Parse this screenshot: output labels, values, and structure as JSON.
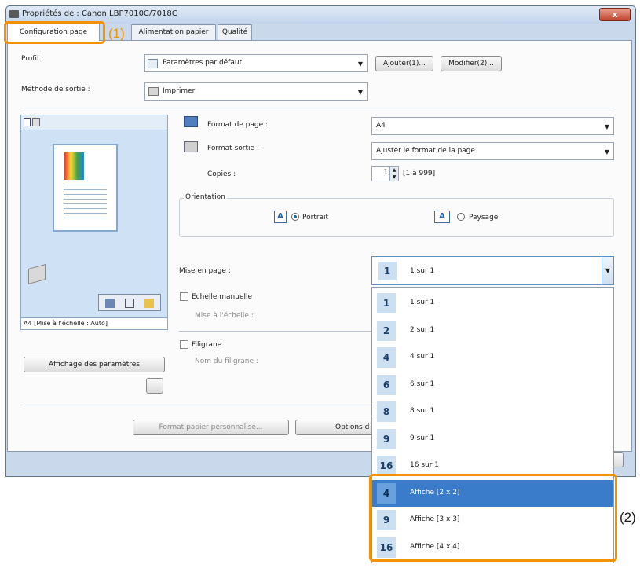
{
  "window": {
    "title": "Propriétés de : Canon LBP7010C/7018C",
    "close": "x"
  },
  "tabs": [
    {
      "label": "Configuration page"
    },
    {
      "label": "Alimentation papier"
    },
    {
      "label": "Qualité"
    }
  ],
  "markers": {
    "m1": "(1)",
    "m2": "(2)"
  },
  "profile": {
    "label": "Profil :",
    "value": "Paramètres par défaut",
    "add_button": "Ajouter(1)...",
    "edit_button": "Modifier(2)..."
  },
  "output_method": {
    "label": "Méthode de sortie :",
    "value": "Imprimer"
  },
  "page_size": {
    "label": "Format de page :",
    "value": "A4"
  },
  "output_size": {
    "label": "Format sortie :",
    "value": "Ajuster le format de la page"
  },
  "copies": {
    "label": "Copies :",
    "value": "1",
    "range": "[1 à 999]"
  },
  "orientation": {
    "title": "Orientation",
    "portrait": "Portrait",
    "landscape": "Paysage"
  },
  "layout": {
    "label": "Mise en page :",
    "value": "1 sur 1",
    "value_num": "1"
  },
  "manual_scale": {
    "label": "Echelle manuelle",
    "sub_label": "Mise à l'échelle :"
  },
  "watermark": {
    "label": "Filigrane",
    "sub_label": "Nom du filigrane :"
  },
  "preview": {
    "status": "A4 [Mise à l'échelle : Auto]"
  },
  "buttons": {
    "show_settings": "Affichage des paramètres",
    "custom_paper": "Format papier personnalisé...",
    "page_options": "Options d"
  },
  "dropdown": {
    "items": [
      {
        "num": "1",
        "label": "1 sur 1",
        "selected": false
      },
      {
        "num": "2",
        "label": "2 sur 1",
        "selected": false
      },
      {
        "num": "4",
        "label": "4 sur 1",
        "selected": false
      },
      {
        "num": "6",
        "label": "6 sur 1",
        "selected": false
      },
      {
        "num": "8",
        "label": "8 sur 1",
        "selected": false
      },
      {
        "num": "9",
        "label": "9 sur 1",
        "selected": false
      },
      {
        "num": "16",
        "label": "16 sur 1",
        "selected": false
      },
      {
        "num": "4",
        "label": "Affiche [2 x 2]",
        "selected": true
      },
      {
        "num": "9",
        "label": "Affiche [3 x 3]",
        "selected": false
      },
      {
        "num": "16",
        "label": "Affiche [4 x 4]",
        "selected": false
      }
    ]
  },
  "colors": {
    "accent": "#f39200",
    "selection": "#3a7cc9",
    "window_frame": "#c9d8eb"
  },
  "icons": {
    "printer": "printer-icon",
    "profile": "profile-icon",
    "page_size": "page-size-icon",
    "output_size": "output-size-icon"
  }
}
